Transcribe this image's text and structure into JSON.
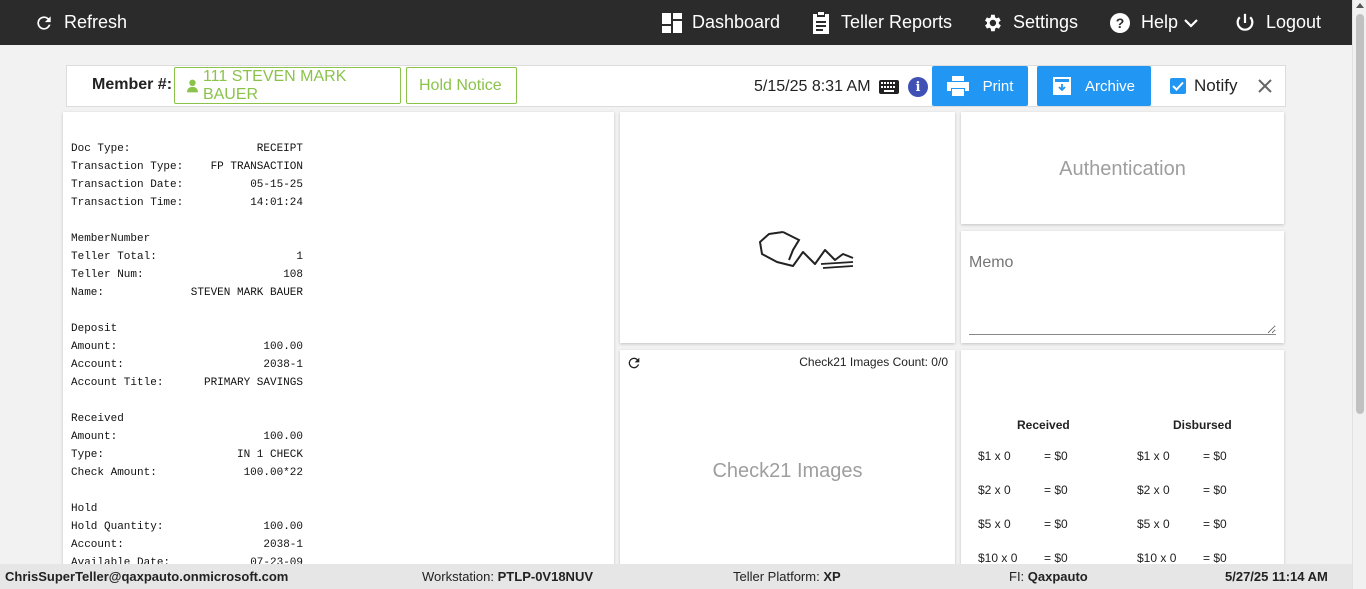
{
  "nav": {
    "refresh": "Refresh",
    "dashboard": "Dashboard",
    "teller_reports": "Teller Reports",
    "settings": "Settings",
    "help": "Help",
    "logout": "Logout"
  },
  "member_bar": {
    "label": "Member #:",
    "member": "111 STEVEN MARK BAUER",
    "hold_notice": "Hold Notice",
    "datetime": "5/15/25 8:31 AM",
    "print": "Print",
    "archive": "Archive",
    "notify": "Notify",
    "notify_checked": true
  },
  "receipt": {
    "sections": [
      {
        "rows": [
          {
            "k": "Doc Type:",
            "v": "RECEIPT"
          },
          {
            "k": "Transaction Type:",
            "v": "FP TRANSACTION"
          },
          {
            "k": "Transaction Date:",
            "v": "05-15-25"
          },
          {
            "k": "Transaction Time:",
            "v": "14:01:24"
          }
        ]
      },
      {
        "title": "MemberNumber",
        "rows": [
          {
            "k": "Teller Total:",
            "v": "1"
          },
          {
            "k": "Teller Num:",
            "v": "108"
          },
          {
            "k": "Name:",
            "v": "STEVEN MARK BAUER"
          }
        ]
      },
      {
        "title": "Deposit",
        "rows": [
          {
            "k": "Amount:",
            "v": "100.00"
          },
          {
            "k": "Account:",
            "v": "2038-1"
          },
          {
            "k": "Account Title:",
            "v": "PRIMARY SAVINGS"
          }
        ]
      },
      {
        "title": "Received",
        "rows": [
          {
            "k": "Amount:",
            "v": "100.00"
          },
          {
            "k": "Type:",
            "v": "IN 1 CHECK"
          },
          {
            "k": "Check Amount:",
            "v": "100.00*22"
          }
        ]
      },
      {
        "title": "Hold",
        "rows": [
          {
            "k": "Hold Quantity:",
            "v": "100.00"
          },
          {
            "k": "Account:",
            "v": "2038-1"
          },
          {
            "k": "Available Date:",
            "v": "07-23-09"
          }
        ]
      }
    ]
  },
  "check21": {
    "count_label": "Check21 Images Count: 0/0",
    "title": "Check21 Images"
  },
  "authentication": {
    "title": "Authentication"
  },
  "memo": {
    "label": "Memo"
  },
  "cash": {
    "received_label": "Received",
    "disbursed_label": "Disbursed",
    "received": [
      {
        "denom": "$1 x 0",
        "total": "= $0"
      },
      {
        "denom": "$2 x 0",
        "total": "= $0"
      },
      {
        "denom": "$5 x 0",
        "total": "= $0"
      },
      {
        "denom": "$10 x 0",
        "total": "= $0"
      }
    ],
    "disbursed": [
      {
        "denom": "$1 x 0",
        "total": "= $0"
      },
      {
        "denom": "$2 x 0",
        "total": "= $0"
      },
      {
        "denom": "$5 x 0",
        "total": "= $0"
      },
      {
        "denom": "$10 x 0",
        "total": "= $0"
      }
    ]
  },
  "status": {
    "user": "ChrisSuperTeller@qaxpauto.onmicrosoft.com",
    "workstation_label": "Workstation:",
    "workstation": "PTLP-0V18NUV",
    "platform_label": "Teller Platform:",
    "platform": "XP",
    "fi_label": "FI:",
    "fi": "Qaxpauto",
    "time": "5/27/25 11:14 AM"
  },
  "colors": {
    "nav_bg": "#2b2b2b",
    "accent_blue": "#2196f3",
    "member_green": "#8bc34a",
    "info_indigo": "#3f51b5"
  },
  "icons": [
    "refresh-icon",
    "dashboard-icon",
    "clipboard-icon",
    "gear-icon",
    "help-icon",
    "chevron-down-icon",
    "power-icon",
    "user-icon",
    "keyboard-icon",
    "info-icon",
    "printer-icon",
    "archive-icon",
    "close-icon"
  ]
}
